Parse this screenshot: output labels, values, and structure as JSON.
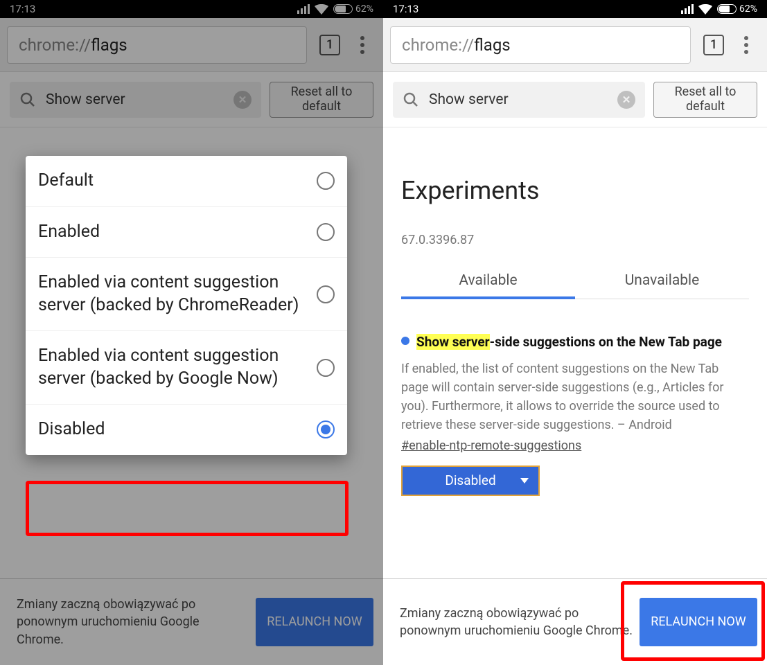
{
  "status": {
    "time": "17:13",
    "battery_pct": "62%"
  },
  "url": {
    "scheme": "chrome://",
    "path": "flags"
  },
  "tab_count": "1",
  "search": {
    "text": "Show server"
  },
  "reset_btn": "Reset all to default",
  "page_title": "Experiments",
  "version": "67.0.3396.87",
  "tabs": {
    "available": "Available",
    "unavailable": "Unavailable"
  },
  "flag": {
    "title_highlight": "Show server",
    "title_rest": "-side suggestions on the New Tab page",
    "desc": "If enabled, the list of content suggestions on the New Tab page will contain server-side suggestions (e.g., Articles for you). Furthermore, it allows to override the source used to retrieve these server-side suggestions. – Android",
    "anchor": "#enable-ntp-remote-suggestions",
    "dropdown_value": "Disabled"
  },
  "footer": {
    "text": "Zmiany zaczną obowiązywać po ponownym uruchomieniu Google Chrome.",
    "relaunch": "RELAUNCH NOW"
  },
  "modal": {
    "options": {
      "o0": "Default",
      "o1": "Enabled",
      "o2": "Enabled via content suggestion server (backed by ChromeReader)",
      "o3": "Enabled via content suggestion server (backed by Google Now)",
      "o4": "Disabled"
    }
  }
}
